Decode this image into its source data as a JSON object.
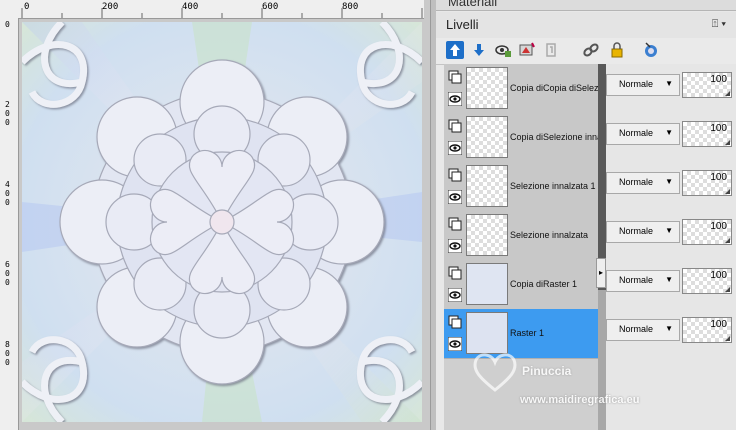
{
  "canvas": {
    "ruler_top_labels": [
      "0",
      "200",
      "400",
      "600",
      "800"
    ],
    "ruler_left_labels": [
      "0",
      "200",
      "400",
      "600",
      "800"
    ]
  },
  "palette": {
    "materials_title": "Materiali",
    "layers_title": "Livelli",
    "window_controls": "⍐ ▾",
    "toolbar_icons": [
      "new-raster-layer-icon",
      "new-vector-layer-icon",
      "new-mask-layer-icon",
      "adjustment-layer-icon",
      "duplicate-layer-icon",
      "link-icon",
      "lock-icon",
      "mask-visibility-icon"
    ]
  },
  "layers": [
    {
      "name": "Copia diCopia diSelezio",
      "blend_mode": "Normale",
      "opacity": "100",
      "selected": false
    },
    {
      "name": "Copia diSelezione inna",
      "blend_mode": "Normale",
      "opacity": "100",
      "selected": false
    },
    {
      "name": "Selezione innalzata 1",
      "blend_mode": "Normale",
      "opacity": "100",
      "selected": false
    },
    {
      "name": "Selezione innalzata",
      "blend_mode": "Normale",
      "opacity": "100",
      "selected": false
    },
    {
      "name": "Copia diRaster 1",
      "blend_mode": "Normale",
      "opacity": "100",
      "selected": false
    },
    {
      "name": "Raster 1",
      "blend_mode": "Normale",
      "opacity": "100",
      "selected": true
    }
  ],
  "watermark": {
    "name": "Pinuccia",
    "url": "www.maidiregrafica.eu"
  },
  "colors": {
    "selected_layer": "#3d9bf0",
    "accent_tool": "#1e6fc8"
  }
}
